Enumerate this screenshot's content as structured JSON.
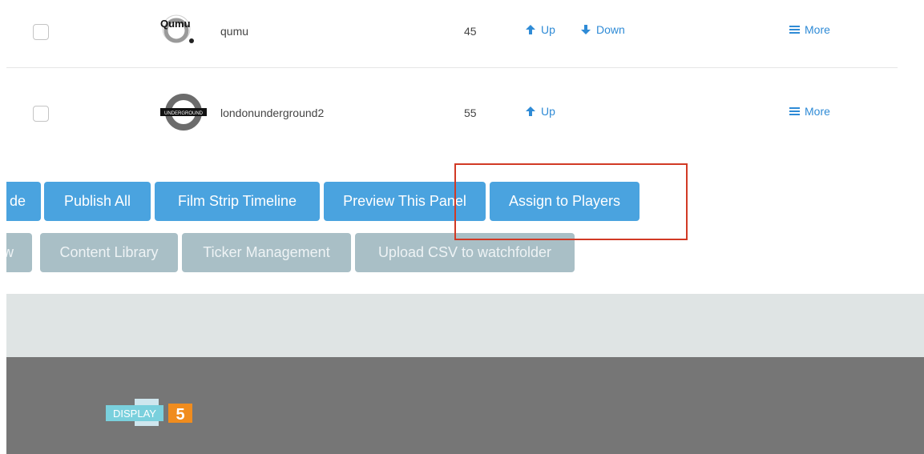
{
  "rows": [
    {
      "logo_text": "Qumu",
      "name": "qumu",
      "value": "45",
      "up_label": "Up",
      "down_label": "Down",
      "more_label": "More"
    },
    {
      "logo_text": "UNDERGROUND",
      "name": "londonunderground2",
      "value": "55",
      "up_label": "Up",
      "more_label": "More"
    }
  ],
  "toolbar": {
    "row1": [
      "de",
      "Publish All",
      "Film Strip Timeline",
      "Preview This Panel",
      "Assign to Players"
    ],
    "row2": [
      "w",
      "Content Library",
      "Ticker Management",
      "Upload CSV to watchfolder"
    ]
  },
  "footer": {
    "brand_text": "DISPLAY",
    "brand_number": "5"
  },
  "colors": {
    "accent": "#2f8bd6",
    "button_blue": "#4aa3df",
    "button_grey": "#a9bfc6",
    "highlight": "#d13a25",
    "footer": "#767676"
  }
}
